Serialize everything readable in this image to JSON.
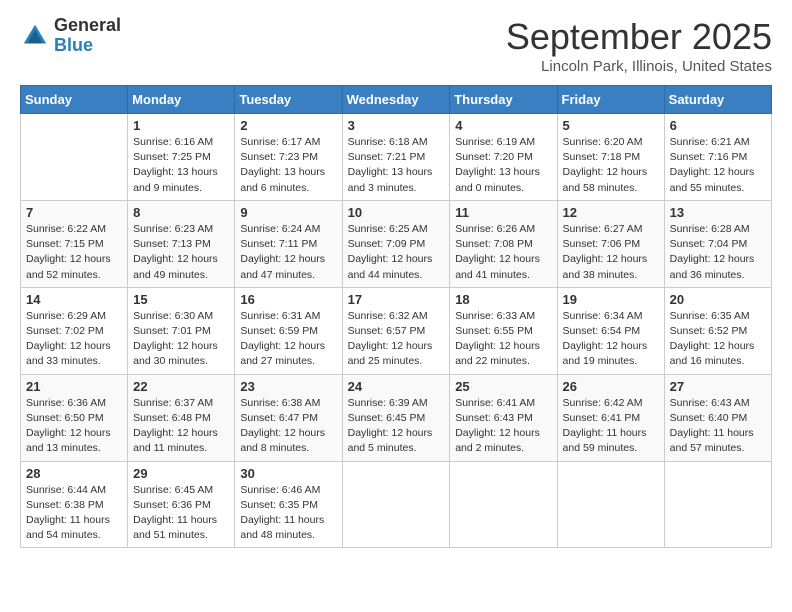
{
  "header": {
    "logo_general": "General",
    "logo_blue": "Blue",
    "month_title": "September 2025",
    "location": "Lincoln Park, Illinois, United States"
  },
  "days_of_week": [
    "Sunday",
    "Monday",
    "Tuesday",
    "Wednesday",
    "Thursday",
    "Friday",
    "Saturday"
  ],
  "weeks": [
    [
      {
        "day": "",
        "sunrise": "",
        "sunset": "",
        "daylight": ""
      },
      {
        "day": "1",
        "sunrise": "Sunrise: 6:16 AM",
        "sunset": "Sunset: 7:25 PM",
        "daylight": "Daylight: 13 hours and 9 minutes."
      },
      {
        "day": "2",
        "sunrise": "Sunrise: 6:17 AM",
        "sunset": "Sunset: 7:23 PM",
        "daylight": "Daylight: 13 hours and 6 minutes."
      },
      {
        "day": "3",
        "sunrise": "Sunrise: 6:18 AM",
        "sunset": "Sunset: 7:21 PM",
        "daylight": "Daylight: 13 hours and 3 minutes."
      },
      {
        "day": "4",
        "sunrise": "Sunrise: 6:19 AM",
        "sunset": "Sunset: 7:20 PM",
        "daylight": "Daylight: 13 hours and 0 minutes."
      },
      {
        "day": "5",
        "sunrise": "Sunrise: 6:20 AM",
        "sunset": "Sunset: 7:18 PM",
        "daylight": "Daylight: 12 hours and 58 minutes."
      },
      {
        "day": "6",
        "sunrise": "Sunrise: 6:21 AM",
        "sunset": "Sunset: 7:16 PM",
        "daylight": "Daylight: 12 hours and 55 minutes."
      }
    ],
    [
      {
        "day": "7",
        "sunrise": "Sunrise: 6:22 AM",
        "sunset": "Sunset: 7:15 PM",
        "daylight": "Daylight: 12 hours and 52 minutes."
      },
      {
        "day": "8",
        "sunrise": "Sunrise: 6:23 AM",
        "sunset": "Sunset: 7:13 PM",
        "daylight": "Daylight: 12 hours and 49 minutes."
      },
      {
        "day": "9",
        "sunrise": "Sunrise: 6:24 AM",
        "sunset": "Sunset: 7:11 PM",
        "daylight": "Daylight: 12 hours and 47 minutes."
      },
      {
        "day": "10",
        "sunrise": "Sunrise: 6:25 AM",
        "sunset": "Sunset: 7:09 PM",
        "daylight": "Daylight: 12 hours and 44 minutes."
      },
      {
        "day": "11",
        "sunrise": "Sunrise: 6:26 AM",
        "sunset": "Sunset: 7:08 PM",
        "daylight": "Daylight: 12 hours and 41 minutes."
      },
      {
        "day": "12",
        "sunrise": "Sunrise: 6:27 AM",
        "sunset": "Sunset: 7:06 PM",
        "daylight": "Daylight: 12 hours and 38 minutes."
      },
      {
        "day": "13",
        "sunrise": "Sunrise: 6:28 AM",
        "sunset": "Sunset: 7:04 PM",
        "daylight": "Daylight: 12 hours and 36 minutes."
      }
    ],
    [
      {
        "day": "14",
        "sunrise": "Sunrise: 6:29 AM",
        "sunset": "Sunset: 7:02 PM",
        "daylight": "Daylight: 12 hours and 33 minutes."
      },
      {
        "day": "15",
        "sunrise": "Sunrise: 6:30 AM",
        "sunset": "Sunset: 7:01 PM",
        "daylight": "Daylight: 12 hours and 30 minutes."
      },
      {
        "day": "16",
        "sunrise": "Sunrise: 6:31 AM",
        "sunset": "Sunset: 6:59 PM",
        "daylight": "Daylight: 12 hours and 27 minutes."
      },
      {
        "day": "17",
        "sunrise": "Sunrise: 6:32 AM",
        "sunset": "Sunset: 6:57 PM",
        "daylight": "Daylight: 12 hours and 25 minutes."
      },
      {
        "day": "18",
        "sunrise": "Sunrise: 6:33 AM",
        "sunset": "Sunset: 6:55 PM",
        "daylight": "Daylight: 12 hours and 22 minutes."
      },
      {
        "day": "19",
        "sunrise": "Sunrise: 6:34 AM",
        "sunset": "Sunset: 6:54 PM",
        "daylight": "Daylight: 12 hours and 19 minutes."
      },
      {
        "day": "20",
        "sunrise": "Sunrise: 6:35 AM",
        "sunset": "Sunset: 6:52 PM",
        "daylight": "Daylight: 12 hours and 16 minutes."
      }
    ],
    [
      {
        "day": "21",
        "sunrise": "Sunrise: 6:36 AM",
        "sunset": "Sunset: 6:50 PM",
        "daylight": "Daylight: 12 hours and 13 minutes."
      },
      {
        "day": "22",
        "sunrise": "Sunrise: 6:37 AM",
        "sunset": "Sunset: 6:48 PM",
        "daylight": "Daylight: 12 hours and 11 minutes."
      },
      {
        "day": "23",
        "sunrise": "Sunrise: 6:38 AM",
        "sunset": "Sunset: 6:47 PM",
        "daylight": "Daylight: 12 hours and 8 minutes."
      },
      {
        "day": "24",
        "sunrise": "Sunrise: 6:39 AM",
        "sunset": "Sunset: 6:45 PM",
        "daylight": "Daylight: 12 hours and 5 minutes."
      },
      {
        "day": "25",
        "sunrise": "Sunrise: 6:41 AM",
        "sunset": "Sunset: 6:43 PM",
        "daylight": "Daylight: 12 hours and 2 minutes."
      },
      {
        "day": "26",
        "sunrise": "Sunrise: 6:42 AM",
        "sunset": "Sunset: 6:41 PM",
        "daylight": "Daylight: 11 hours and 59 minutes."
      },
      {
        "day": "27",
        "sunrise": "Sunrise: 6:43 AM",
        "sunset": "Sunset: 6:40 PM",
        "daylight": "Daylight: 11 hours and 57 minutes."
      }
    ],
    [
      {
        "day": "28",
        "sunrise": "Sunrise: 6:44 AM",
        "sunset": "Sunset: 6:38 PM",
        "daylight": "Daylight: 11 hours and 54 minutes."
      },
      {
        "day": "29",
        "sunrise": "Sunrise: 6:45 AM",
        "sunset": "Sunset: 6:36 PM",
        "daylight": "Daylight: 11 hours and 51 minutes."
      },
      {
        "day": "30",
        "sunrise": "Sunrise: 6:46 AM",
        "sunset": "Sunset: 6:35 PM",
        "daylight": "Daylight: 11 hours and 48 minutes."
      },
      {
        "day": "",
        "sunrise": "",
        "sunset": "",
        "daylight": ""
      },
      {
        "day": "",
        "sunrise": "",
        "sunset": "",
        "daylight": ""
      },
      {
        "day": "",
        "sunrise": "",
        "sunset": "",
        "daylight": ""
      },
      {
        "day": "",
        "sunrise": "",
        "sunset": "",
        "daylight": ""
      }
    ]
  ]
}
